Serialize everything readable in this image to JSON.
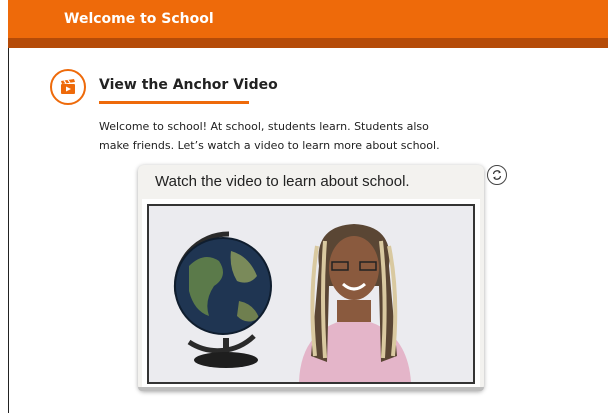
{
  "header": {
    "title": "Welcome to School"
  },
  "section": {
    "icon": "video-clapper-icon",
    "title": "View the Anchor Video",
    "intro": "Welcome to school! At school, students learn. Students also make friends. Let’s watch a video to learn more about school."
  },
  "video_card": {
    "title": "Watch the video to learn about school.",
    "refresh_icon": "refresh-icon"
  },
  "colors": {
    "accent": "#ee6a0a",
    "accent_dark": "#b54b08"
  }
}
